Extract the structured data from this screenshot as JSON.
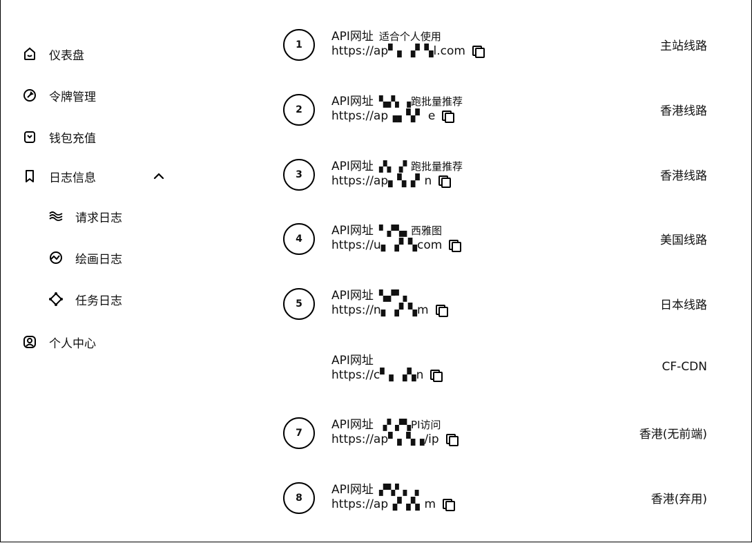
{
  "sidebar": {
    "items": [
      {
        "label": "仪表盘",
        "icon": "dashboard-icon"
      },
      {
        "label": "令牌管理",
        "icon": "key-icon"
      },
      {
        "label": "钱包充值",
        "icon": "wallet-icon"
      },
      {
        "label": "日志信息",
        "icon": "bookmark-icon"
      },
      {
        "label": "个人中心",
        "icon": "user-icon"
      }
    ],
    "sub_items": [
      {
        "label": "请求日志",
        "icon": "waves-icon"
      },
      {
        "label": "绘画日志",
        "icon": "chart-circle-icon"
      },
      {
        "label": "任务日志",
        "icon": "nodes-icon"
      }
    ]
  },
  "api_list": [
    {
      "badge": "1",
      "title": "API网址",
      "desc": "适合个人使用",
      "url": "https://ap▘▖▗▘▚l.com",
      "route": "主站线路"
    },
    {
      "badge": "2",
      "title": "API网址",
      "desc": "▚▞▖▗跑批量推荐",
      "url": "https://ap▗▖▚▘ e",
      "route": "香港线路"
    },
    {
      "badge": "3",
      "title": "API网址",
      "desc": "▞▖▗▘跑批量推荐",
      "url": "https://ap▖▚▗▘n",
      "route": "香港线路"
    },
    {
      "badge": "4",
      "title": "API网址",
      "desc": "▘▞▚▖西雅图",
      "url": "https://u▖▗▘▚com",
      "route": "美国线路"
    },
    {
      "badge": "5",
      "title": "API网址",
      "desc": "▚▞▘▖",
      "url": "https://n▖▗▘▚m",
      "route": "日本线路"
    },
    {
      "badge": "",
      "title": "API网址",
      "desc": "",
      "url": "https://c▘▖▗▚n",
      "route": "CF-CDN"
    },
    {
      "badge": "7",
      "title": "API网址",
      "desc": "▗▘▞▚PI访问",
      "url": "https://ap▘▖▚▗/ip",
      "route": "香港(无前端)"
    },
    {
      "badge": "8",
      "title": "API网址",
      "desc": "▞▚▘▖▗",
      "url": "https://ap▗▘▞▖m",
      "route": "香港(弃用)"
    }
  ]
}
